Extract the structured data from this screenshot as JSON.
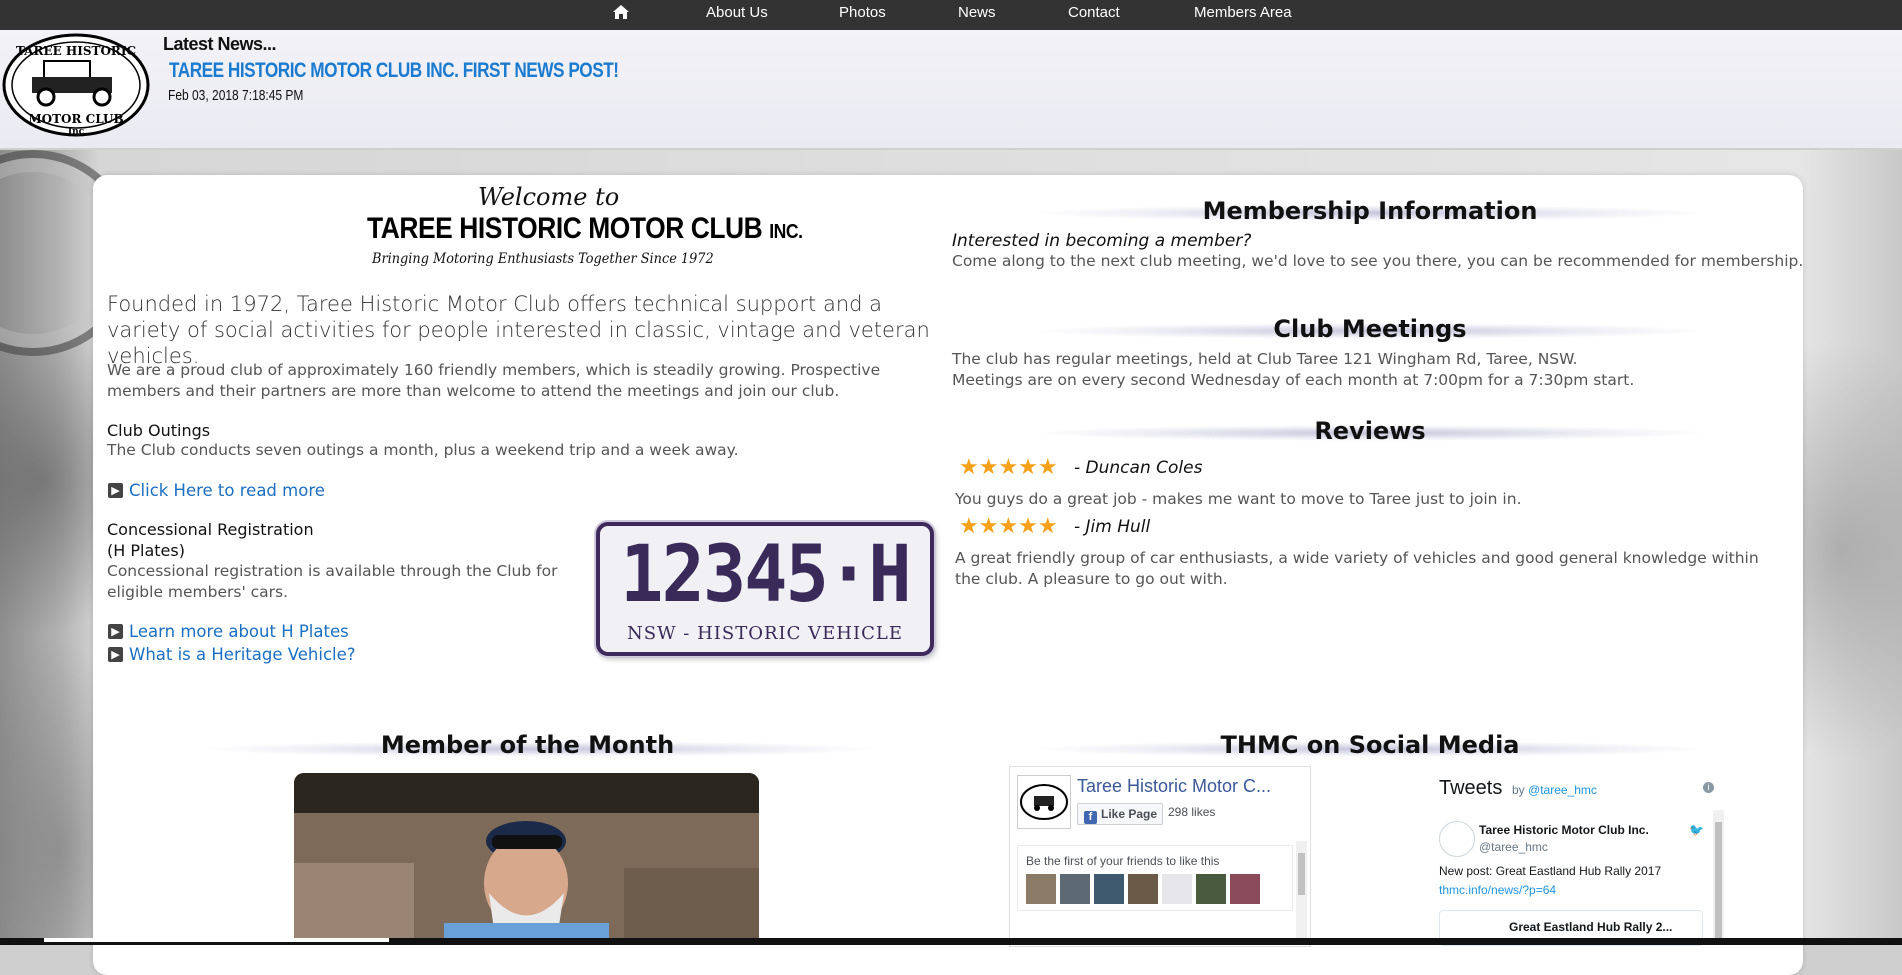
{
  "nav": {
    "items": [
      {
        "label": "About Us"
      },
      {
        "label": "Photos"
      },
      {
        "label": "News"
      },
      {
        "label": "Contact"
      },
      {
        "label": "Members Area"
      }
    ]
  },
  "header": {
    "logo_text_top": "TAREE HISTORIC",
    "logo_text_bottom": "MOTOR CLUB",
    "logo_text_inc": "Inc",
    "latest_label": "Latest News...",
    "news_title": "TAREE HISTORIC MOTOR CLUB INC. FIRST NEWS POST!",
    "news_date": "Feb 03, 2018 7:18:45 PM"
  },
  "welcome": {
    "script": "Welcome to",
    "club": "TAREE HISTORIC MOTOR CLUB",
    "club_inc": "INC.",
    "tagline": "Bringing Motoring Enthusiasts Together Since 1972"
  },
  "left": {
    "lead": "Founded in 1972, Taree Historic Motor Club offers technical support and a variety of social activities for people interested in classic, vintage and veteran vehicles.",
    "proud": "We are a proud club of approximately 160 friendly members, which is steadily growing. Prospective members and their partners are more than welcome to attend the meetings and join our club.",
    "outings_head": "Club Outings",
    "outings_text": "The Club conducts seven outings a month, plus a weekend trip and a week away.",
    "read_more": "Click Here to read more",
    "concession_head": "Concessional Registration",
    "concession_head2": "(H Plates)",
    "concession_text": "Concessional registration is available through the Club for eligible members' cars.",
    "learn_more": "Learn more about H Plates",
    "heritage": "What is a Heritage Vehicle?",
    "plate_number": "12345·H",
    "plate_caption": "NSW - HISTORIC  VEHICLE"
  },
  "membership": {
    "title": "Membership Information",
    "question": "Interested in becoming a member?",
    "text": "Come along to the next club meeting, we'd love to see you there, you can be recommended for membership."
  },
  "meetings": {
    "title": "Club Meetings",
    "line1": "The club has regular meetings, held at Club Taree 121 Wingham Rd, Taree, NSW.",
    "line2": "Meetings are on every second Wednesday of each month at 7:00pm for a 7:30pm start."
  },
  "reviews": {
    "title": "Reviews",
    "items": [
      {
        "stars": "★★★★★",
        "author": "- Duncan Coles",
        "text": "You guys do a great job - makes me want to move to Taree just to join in."
      },
      {
        "stars": "★★★★★",
        "author": "- Jim Hull",
        "text": "A great friendly group of car enthusiasts, a wide variety of vehicles and good general knowledge within the club. A pleasure to go out with."
      }
    ]
  },
  "motm": {
    "title": "Member of the Month"
  },
  "social": {
    "title": "THMC on Social Media",
    "fb_name": "Taree Historic Motor C...",
    "fb_like": "Like Page",
    "fb_likes": "298 likes",
    "fb_friends": "Be the first of your friends to like this",
    "tw_title": "Tweets",
    "tw_by": "by",
    "tw_handle_link": "@taree_hmc",
    "tw_name": "Taree Historic Motor Club Inc.",
    "tw_handle": "@taree_hmc",
    "tw_post": "New post: Great Eastland Hub Rally 2017",
    "tw_link": "thmc.info/news/?p=64",
    "tw_card": "Great Eastland Hub Rally 2..."
  },
  "colors": {
    "nav_bg": "#333333",
    "link": "#1b6fc2",
    "news_title": "#1a7bd1",
    "star": "#f5a11a",
    "plate": "#3a2a5a"
  }
}
